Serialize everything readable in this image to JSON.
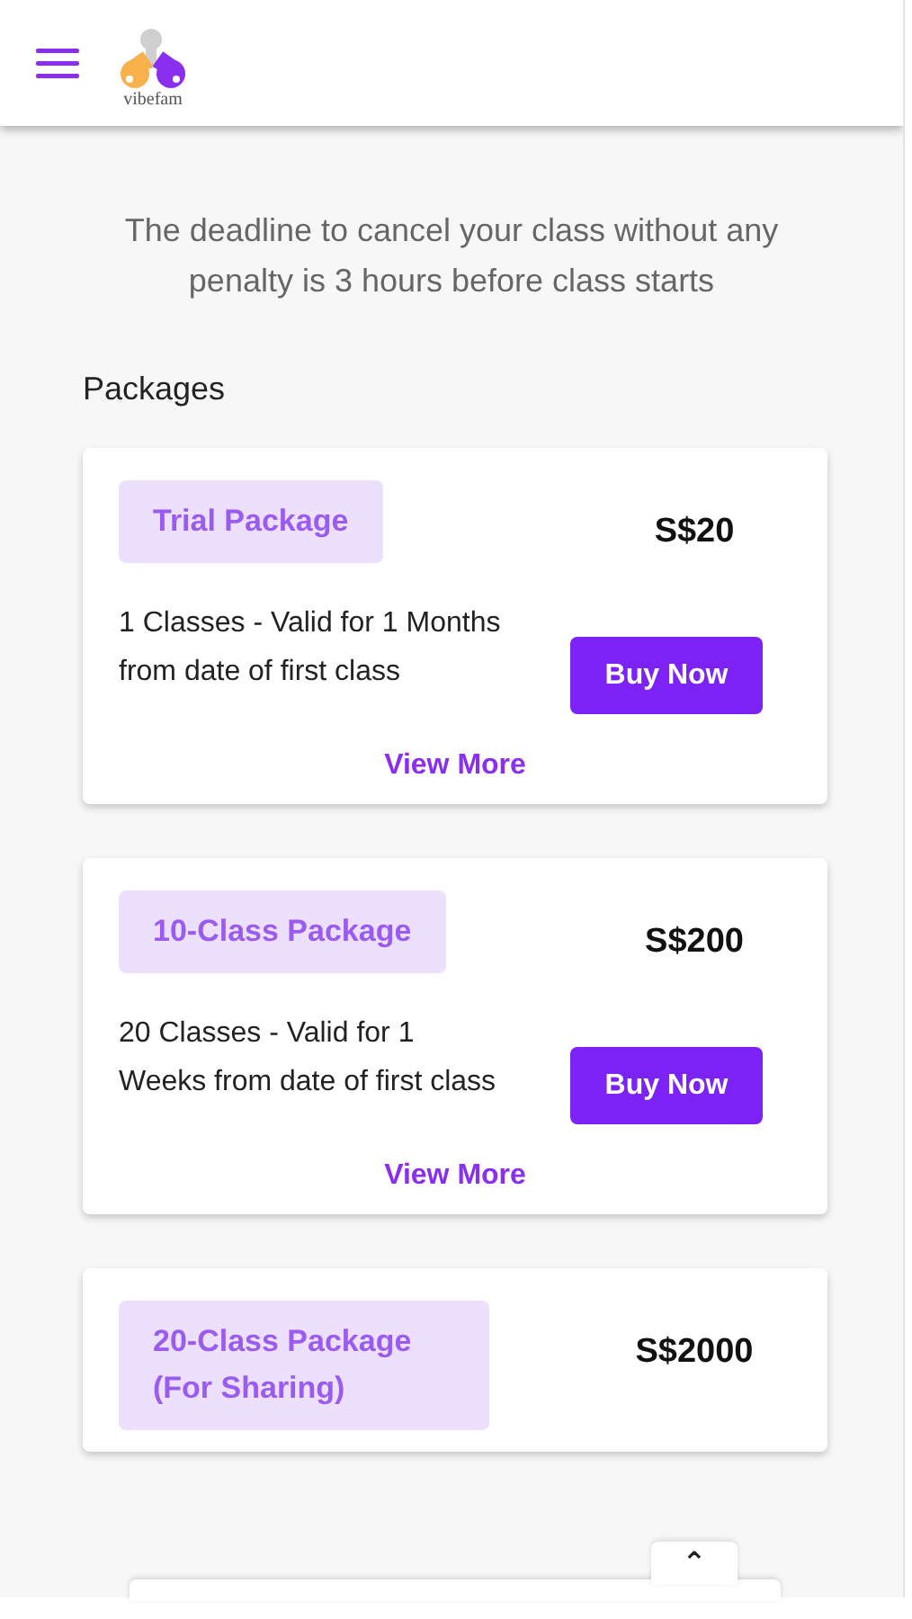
{
  "header": {
    "logo_text": "vibefam"
  },
  "notice": "The deadline to cancel your class without any penalty is 3 hours before class starts",
  "section_title": "Packages",
  "packages": [
    {
      "name": "Trial Package",
      "price": "S$20",
      "description": "1 Classes - Valid for 1 Months from date of first class",
      "buy_label": "Buy Now",
      "more_label": "View More"
    },
    {
      "name": "10-Class Package",
      "price": "S$200",
      "description": "20 Classes - Valid for 1 Weeks from date of first class",
      "buy_label": "Buy Now",
      "more_label": "View More"
    },
    {
      "name": "20-Class Package (For Sharing)",
      "price": "S$2000"
    }
  ],
  "bottom_sheet": {
    "handle": "⌃"
  }
}
